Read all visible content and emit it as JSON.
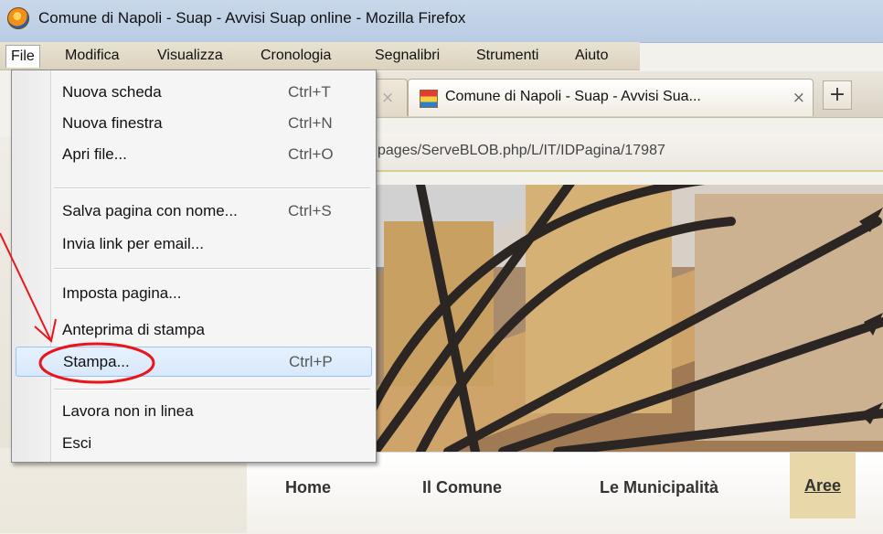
{
  "window": {
    "title": "Comune di Napoli - Suap - Avvisi Suap online - Mozilla Firefox"
  },
  "menubar": {
    "items": [
      {
        "label": "File",
        "open": true
      },
      {
        "label": "Modifica"
      },
      {
        "label": "Visualizza"
      },
      {
        "label": "Cronologia"
      },
      {
        "label": "Segnalibri"
      },
      {
        "label": "Strumenti"
      },
      {
        "label": "Aiuto"
      }
    ]
  },
  "tabs": {
    "faded_close": "×",
    "active": {
      "title": "Comune di Napoli - Suap - Avvisi Sua...",
      "close": "×"
    },
    "new_tab": "+"
  },
  "url": "pages/ServeBLOB.php/L/IT/IDPagina/17987",
  "file_menu": {
    "items": [
      {
        "label": "Nuova scheda",
        "shortcut": "Ctrl+T"
      },
      {
        "label": "Nuova finestra",
        "shortcut": "Ctrl+N"
      },
      {
        "label": "Apri file...",
        "shortcut": "Ctrl+O"
      },
      {
        "label": "Salva pagina con nome...",
        "shortcut": "Ctrl+S"
      },
      {
        "label": "Invia link per email...",
        "shortcut": ""
      },
      {
        "label": "Imposta pagina...",
        "shortcut": ""
      },
      {
        "label": "Anteprima di stampa",
        "shortcut": ""
      },
      {
        "label": "Stampa...",
        "shortcut": "Ctrl+P",
        "highlighted": true
      },
      {
        "label": "Lavora non in linea",
        "shortcut": ""
      },
      {
        "label": "Esci",
        "shortcut": ""
      }
    ]
  },
  "site_nav": {
    "items": [
      {
        "label": "Home"
      },
      {
        "label": "Il Comune"
      },
      {
        "label": "Le Municipalità"
      },
      {
        "label": "Aree"
      }
    ]
  },
  "colors": {
    "annotation": "#e8161a",
    "highlight": "#d8e8fb",
    "nav_highlight": "#e7d7a9"
  }
}
